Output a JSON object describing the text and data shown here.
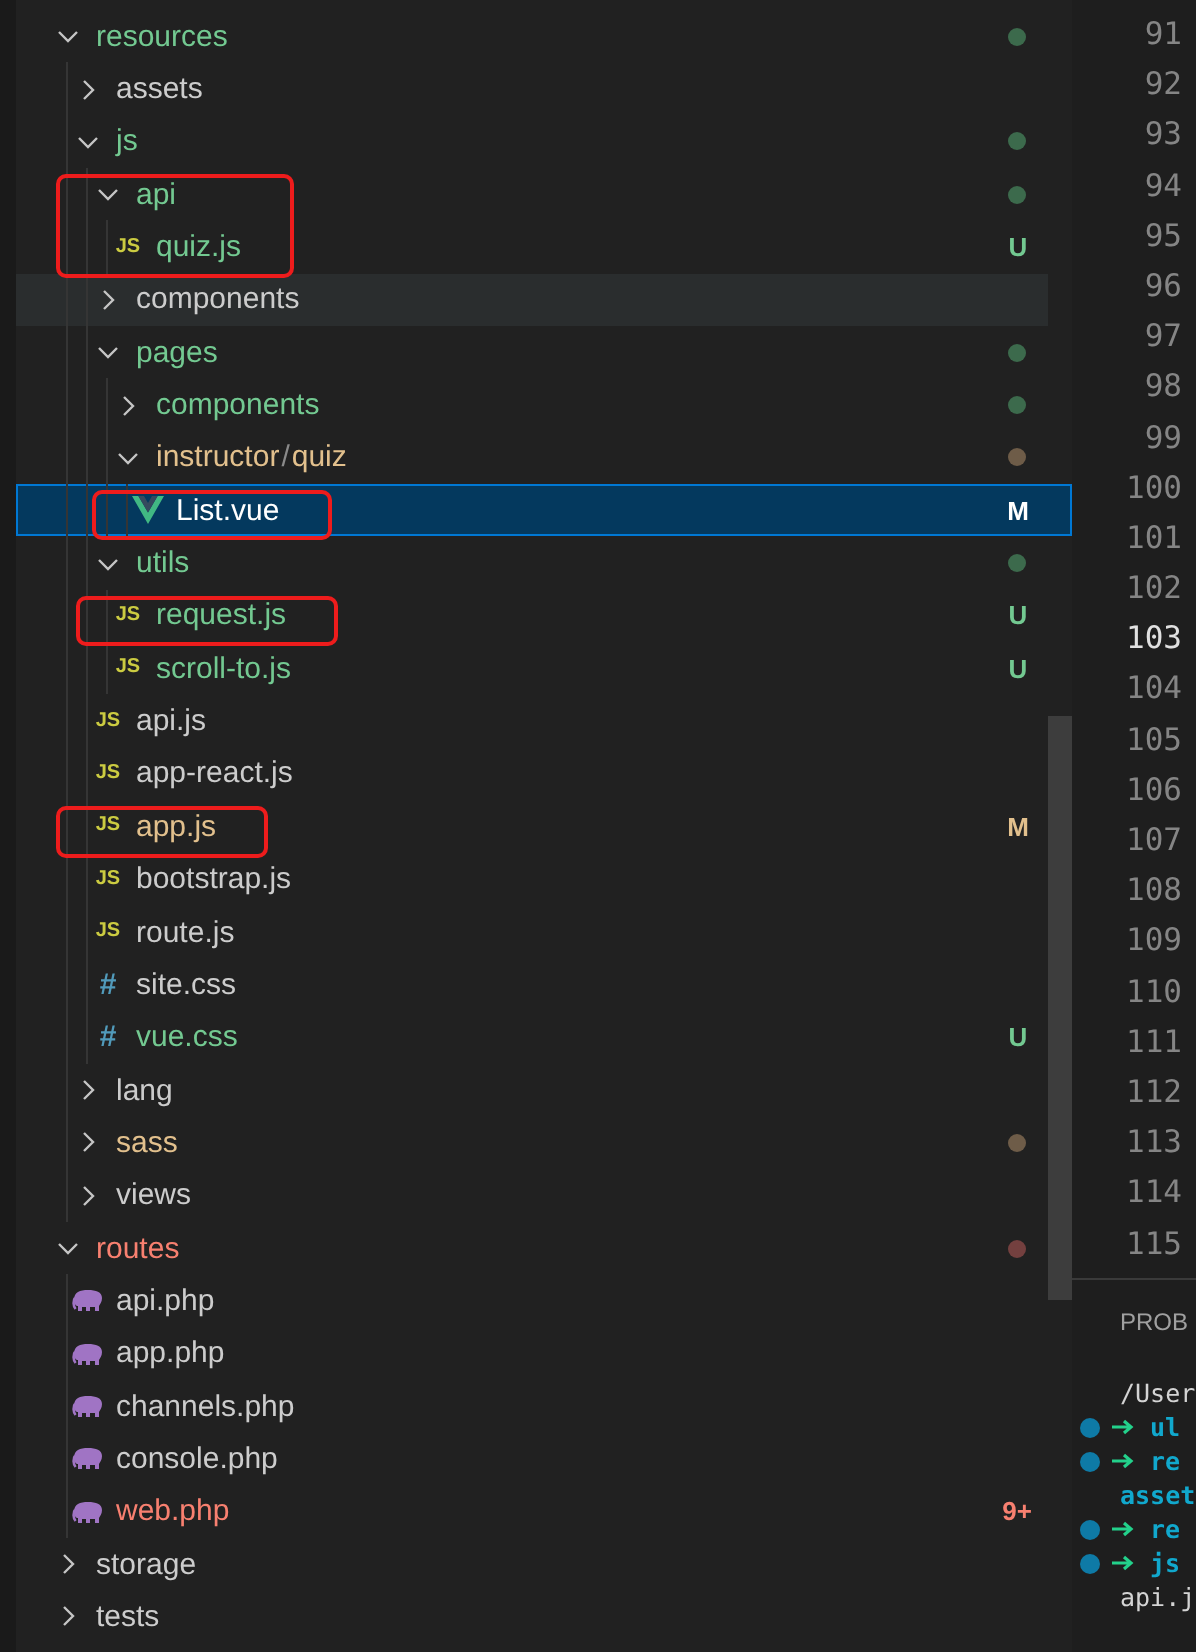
{
  "explorer": {
    "items": [
      {
        "name": "resources",
        "kind": "folder",
        "expanded": true,
        "color": "#73c991",
        "dot": {
          "color": "#3c6a4c"
        },
        "selected": false,
        "hovered": false,
        "annotated": false,
        "children": [
          {
            "name": "assets",
            "kind": "folder",
            "expanded": false,
            "color": "#cccccc",
            "selected": false,
            "hovered": false,
            "annotated": false
          },
          {
            "name": "js",
            "kind": "folder",
            "expanded": true,
            "color": "#73c991",
            "dot": {
              "color": "#3c6a4c"
            },
            "selected": false,
            "hovered": false,
            "annotated": false,
            "children": [
              {
                "name": "api",
                "kind": "folder",
                "expanded": true,
                "color": "#73c991",
                "dot": {
                  "color": "#3c6a4c"
                },
                "selected": false,
                "hovered": false,
                "annotated": true,
                "children": [
                  {
                    "name": "quiz.js",
                    "kind": "js",
                    "icon": "JS",
                    "color": "#73c991",
                    "badge": "U",
                    "selected": false,
                    "hovered": false,
                    "annotated": true
                  }
                ]
              },
              {
                "name": "components",
                "kind": "folder",
                "expanded": false,
                "color": "#cccccc",
                "selected": false,
                "hovered": true,
                "annotated": false
              },
              {
                "name": "pages",
                "kind": "folder",
                "expanded": true,
                "color": "#73c991",
                "dot": {
                  "color": "#3c6a4c"
                },
                "selected": false,
                "hovered": false,
                "annotated": false,
                "children": [
                  {
                    "name": "components",
                    "kind": "folder",
                    "expanded": false,
                    "color": "#73c991",
                    "dot": {
                      "color": "#3c6a4c"
                    },
                    "selected": false,
                    "hovered": false,
                    "annotated": false
                  },
                  {
                    "segments": [
                      "instructor",
                      "quiz"
                    ],
                    "separator": "/",
                    "kind": "folder",
                    "expanded": true,
                    "color": "#e2c08d",
                    "dot": {
                      "color": "#6e5c48"
                    },
                    "selected": false,
                    "hovered": false,
                    "annotated": false,
                    "children": [
                      {
                        "name": "List.vue",
                        "kind": "vue",
                        "color": "#ffffff",
                        "badge": "M",
                        "selected": true,
                        "hovered": false,
                        "annotated": true
                      }
                    ]
                  }
                ]
              },
              {
                "name": "utils",
                "kind": "folder",
                "expanded": true,
                "color": "#73c991",
                "dot": {
                  "color": "#3c6a4c"
                },
                "selected": false,
                "hovered": false,
                "annotated": false,
                "children": [
                  {
                    "name": "request.js",
                    "kind": "js",
                    "icon": "JS",
                    "color": "#73c991",
                    "badge": "U",
                    "selected": false,
                    "hovered": false,
                    "annotated": true
                  },
                  {
                    "name": "scroll-to.js",
                    "kind": "js",
                    "icon": "JS",
                    "color": "#73c991",
                    "badge": "U",
                    "selected": false,
                    "hovered": false,
                    "annotated": false
                  }
                ]
              },
              {
                "name": "api.js",
                "kind": "js",
                "icon": "JS",
                "color": "#cccccc",
                "selected": false,
                "hovered": false,
                "annotated": false
              },
              {
                "name": "app-react.js",
                "kind": "js",
                "icon": "JS",
                "color": "#cccccc",
                "selected": false,
                "hovered": false,
                "annotated": false
              },
              {
                "name": "app.js",
                "kind": "js",
                "icon": "JS",
                "color": "#e2c08d",
                "badge": "M",
                "selected": false,
                "hovered": false,
                "annotated": true
              },
              {
                "name": "bootstrap.js",
                "kind": "js",
                "icon": "JS",
                "color": "#cccccc",
                "selected": false,
                "hovered": false,
                "annotated": false
              },
              {
                "name": "route.js",
                "kind": "js",
                "icon": "JS",
                "color": "#cccccc",
                "selected": false,
                "hovered": false,
                "annotated": false
              },
              {
                "name": "site.css",
                "kind": "css",
                "icon": "#",
                "color": "#cccccc",
                "selected": false,
                "hovered": false,
                "annotated": false
              },
              {
                "name": "vue.css",
                "kind": "css",
                "icon": "#",
                "color": "#73c991",
                "badge": "U",
                "selected": false,
                "hovered": false,
                "annotated": false
              }
            ]
          },
          {
            "name": "lang",
            "kind": "folder",
            "expanded": false,
            "color": "#cccccc",
            "selected": false,
            "hovered": false,
            "annotated": false
          },
          {
            "name": "sass",
            "kind": "folder",
            "expanded": false,
            "color": "#e2c08d",
            "dot": {
              "color": "#6e5c48"
            },
            "selected": false,
            "hovered": false,
            "annotated": false
          },
          {
            "name": "views",
            "kind": "folder",
            "expanded": false,
            "color": "#cccccc",
            "selected": false,
            "hovered": false,
            "annotated": false
          }
        ]
      },
      {
        "name": "routes",
        "kind": "folder",
        "expanded": true,
        "color": "#f88070",
        "dot": {
          "color": "#74403f"
        },
        "selected": false,
        "hovered": false,
        "annotated": false,
        "children": [
          {
            "name": "api.php",
            "kind": "php",
            "color": "#cccccc",
            "selected": false,
            "hovered": false,
            "annotated": false
          },
          {
            "name": "app.php",
            "kind": "php",
            "color": "#cccccc",
            "selected": false,
            "hovered": false,
            "annotated": false
          },
          {
            "name": "channels.php",
            "kind": "php",
            "color": "#cccccc",
            "selected": false,
            "hovered": false,
            "annotated": false
          },
          {
            "name": "console.php",
            "kind": "php",
            "color": "#cccccc",
            "selected": false,
            "hovered": false,
            "annotated": false
          },
          {
            "name": "web.php",
            "kind": "php",
            "color": "#f88070",
            "badge": "9+",
            "selected": false,
            "hovered": false,
            "annotated": false
          }
        ]
      },
      {
        "name": "storage",
        "kind": "folder",
        "expanded": false,
        "color": "#cccccc",
        "selected": false,
        "hovered": false,
        "annotated": false
      },
      {
        "name": "tests",
        "kind": "folder",
        "expanded": false,
        "color": "#cccccc",
        "selected": false,
        "hovered": false,
        "annotated": false
      }
    ]
  },
  "editor": {
    "line_numbers": [
      {
        "number": "91",
        "current": false
      },
      {
        "number": "92",
        "current": false
      },
      {
        "number": "93",
        "current": false
      },
      {
        "number": "94",
        "current": false
      },
      {
        "number": "95",
        "current": false
      },
      {
        "number": "96",
        "current": false
      },
      {
        "number": "97",
        "current": false
      },
      {
        "number": "98",
        "current": false
      },
      {
        "number": "99",
        "current": false
      },
      {
        "number": "100",
        "current": false
      },
      {
        "number": "101",
        "current": false
      },
      {
        "number": "102",
        "current": false
      },
      {
        "number": "103",
        "current": true
      },
      {
        "number": "104",
        "current": false
      },
      {
        "number": "105",
        "current": false
      },
      {
        "number": "106",
        "current": false
      },
      {
        "number": "107",
        "current": false
      },
      {
        "number": "108",
        "current": false
      },
      {
        "number": "109",
        "current": false
      },
      {
        "number": "110",
        "current": false
      },
      {
        "number": "111",
        "current": false
      },
      {
        "number": "112",
        "current": false
      },
      {
        "number": "113",
        "current": false
      },
      {
        "number": "114",
        "current": false
      },
      {
        "number": "115",
        "current": false
      }
    ]
  },
  "panel": {
    "tab": "PROB",
    "terminal": [
      {
        "kind": "plain",
        "text": "/User"
      },
      {
        "kind": "step",
        "text": "ul"
      },
      {
        "kind": "step",
        "text": "re"
      },
      {
        "kind": "wrapped",
        "text": "asset"
      },
      {
        "kind": "step",
        "text": "re"
      },
      {
        "kind": "step",
        "text": "js"
      },
      {
        "kind": "plain",
        "text": "api.j"
      }
    ]
  }
}
